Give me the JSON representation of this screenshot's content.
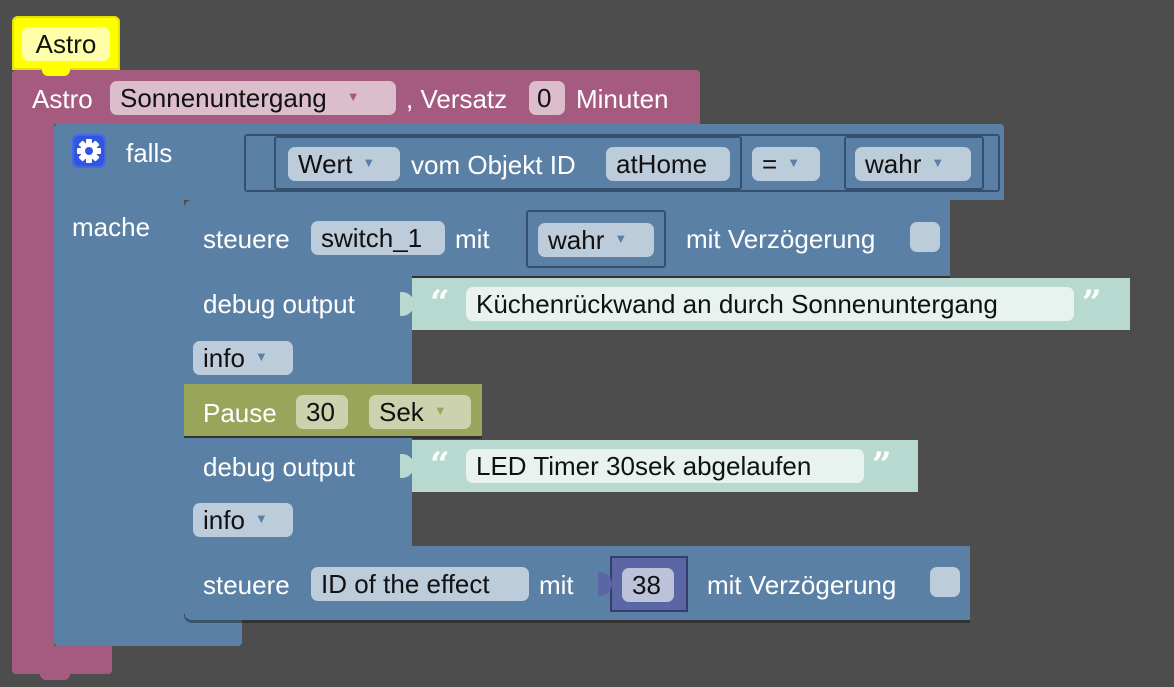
{
  "hat": {
    "label": "Astro"
  },
  "astro": {
    "label": "Astro",
    "event": "Sonnenuntergang",
    "offset_label": ", Versatz",
    "offset_value": "0",
    "unit_label": "Minuten"
  },
  "if_block": {
    "falls_label": "falls",
    "mache_label": "mache",
    "condition": {
      "value_label": "Wert",
      "from_label": "vom Objekt ID",
      "object_id": "atHome",
      "operator": "=",
      "compare_value": "wahr"
    }
  },
  "statements": {
    "control1": {
      "label": "steuere",
      "target": "switch_1",
      "with_label": "mit",
      "value": "wahr",
      "delay_label": "mit Verzögerung"
    },
    "debug1": {
      "label": "debug output",
      "text": "Küchenrückwand an durch Sonnenuntergang",
      "level": "info"
    },
    "pause": {
      "label": "Pause",
      "value": "30",
      "unit": "Sek"
    },
    "debug2": {
      "label": "debug output",
      "text": "LED Timer 30sek abgelaufen",
      "level": "info"
    },
    "control2": {
      "label": "steuere",
      "target": "ID of the effect",
      "with_label": "mit",
      "value": "38",
      "delay_label": "mit Verzögerung"
    }
  },
  "colors": {
    "astro": "#a55b80",
    "hat": "#ffff00",
    "logic": "#5b80a5",
    "text": "#b8d9cf",
    "pause": "#99a55b",
    "background": "#4d4d4d",
    "gear": "#3355dd"
  }
}
